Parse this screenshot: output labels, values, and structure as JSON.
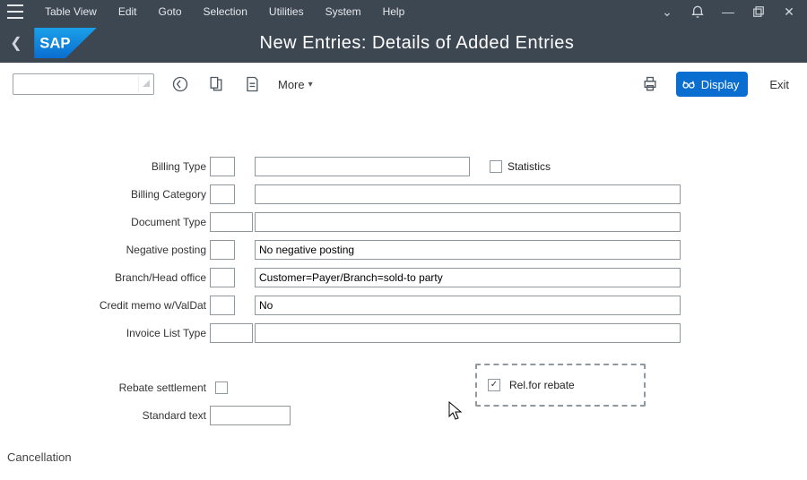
{
  "menubar": {
    "items": [
      "Table View",
      "Edit",
      "Goto",
      "Selection",
      "Utilities",
      "System",
      "Help"
    ]
  },
  "header": {
    "title": "New Entries: Details of Added Entries"
  },
  "toolbar": {
    "more_label": "More",
    "display_label": "Display",
    "exit_label": "Exit"
  },
  "fields": [
    {
      "label": "Billing Type",
      "short": "",
      "desc": "",
      "extra_checkbox_label": "Statistics"
    },
    {
      "label": "Billing Category",
      "short": "",
      "desc": ""
    },
    {
      "label": "Document Type",
      "short": "",
      "desc": ""
    },
    {
      "label": "Negative posting",
      "short": "",
      "desc": "No negative posting"
    },
    {
      "label": "Branch/Head office",
      "short": "",
      "desc": "Customer=Payer/Branch=sold-to party"
    },
    {
      "label": "Credit memo w/ValDat",
      "short": "",
      "desc": "No"
    },
    {
      "label": "Invoice List Type",
      "short": "",
      "desc": ""
    }
  ],
  "lower": {
    "rebate_settlement_label": "Rebate settlement",
    "standard_text_label": "Standard text",
    "rel_for_rebate_label": "Rel.for rebate",
    "rel_for_rebate_checked": true
  },
  "section": {
    "cancellation": "Cancellation"
  }
}
